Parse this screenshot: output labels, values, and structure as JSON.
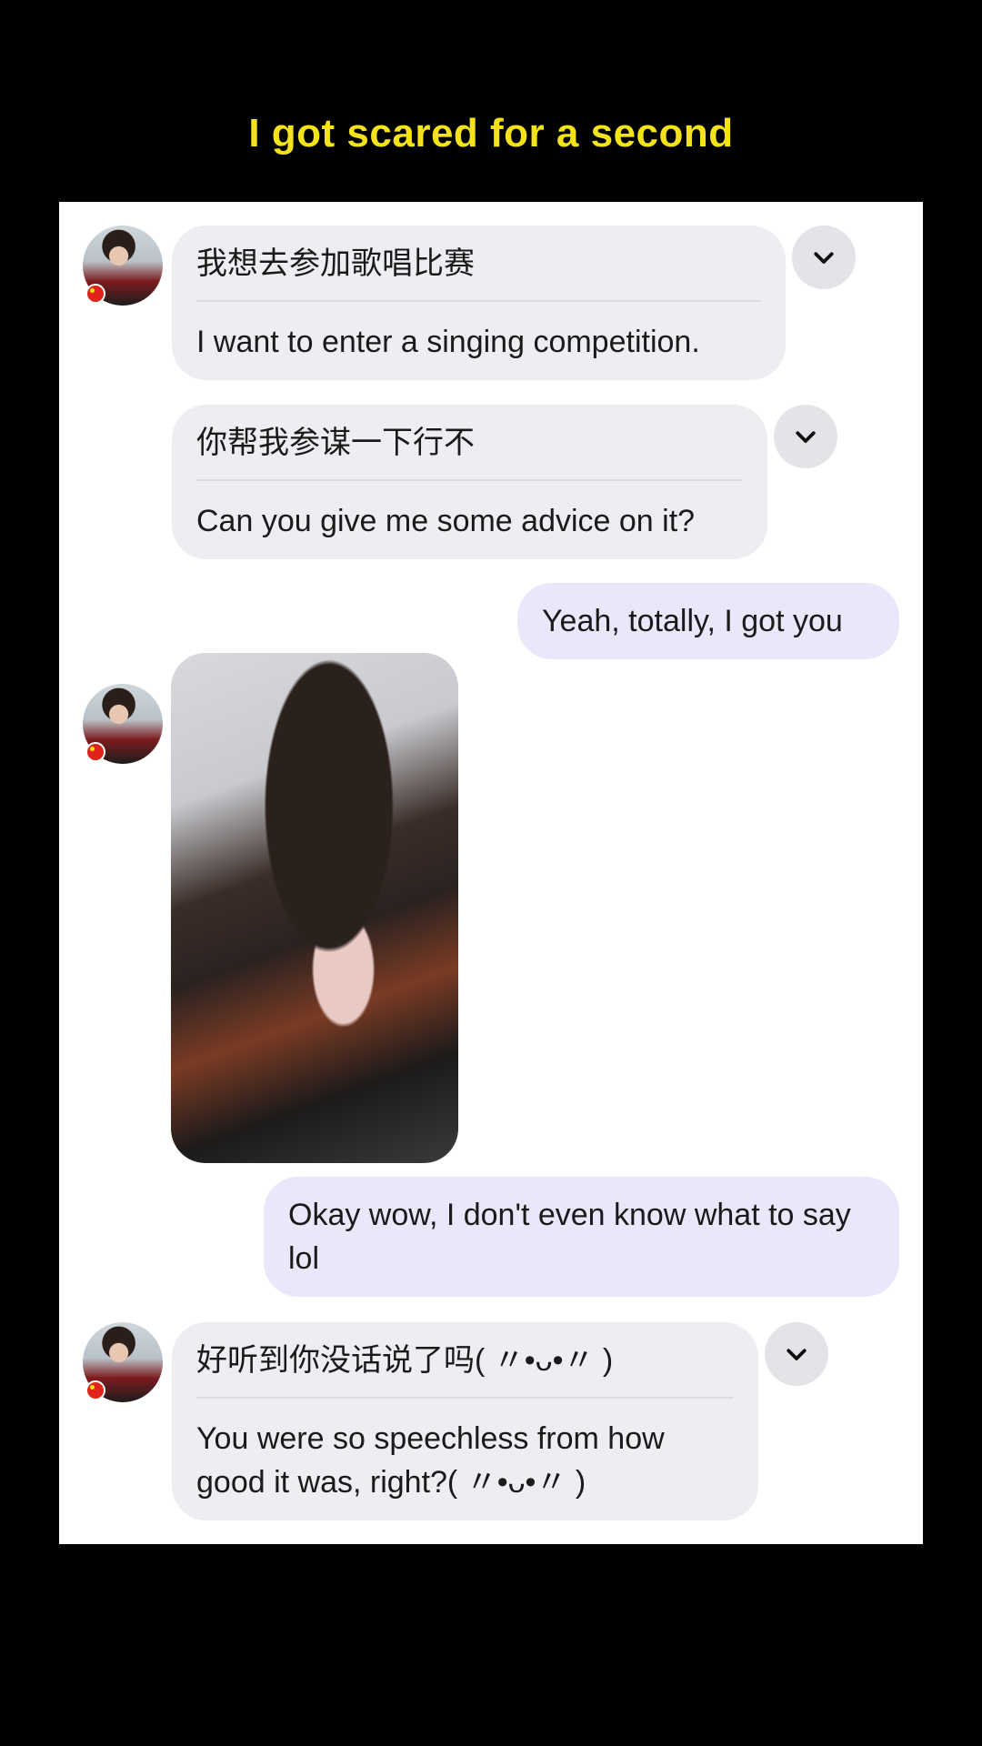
{
  "caption": "I got scared for a second",
  "messages": [
    {
      "type": "received",
      "original": "我想去参加歌唱比赛",
      "translation": "I want to enter a singing competition."
    },
    {
      "type": "received",
      "original": "你帮我参谋一下行不",
      "translation": "Can you give me some advice on it?"
    },
    {
      "type": "sent",
      "text": "Yeah, totally, I got you"
    },
    {
      "type": "received_image",
      "alt": "selfie photo"
    },
    {
      "type": "sent",
      "text": "Okay wow, I don't even know what to say lol"
    },
    {
      "type": "received",
      "original": "好听到你没话说了吗( 〃•ᴗ•〃 )",
      "translation": "You were so speechless from how good it was, right?( 〃•ᴗ•〃 )"
    }
  ],
  "icons": {
    "expand": "chevron-down-icon",
    "flag": "china-flag-icon"
  },
  "colors": {
    "caption": "#f4e31a",
    "received_bubble": "#eeeef2",
    "sent_bubble": "#e9e8fb",
    "background": "#000000"
  }
}
